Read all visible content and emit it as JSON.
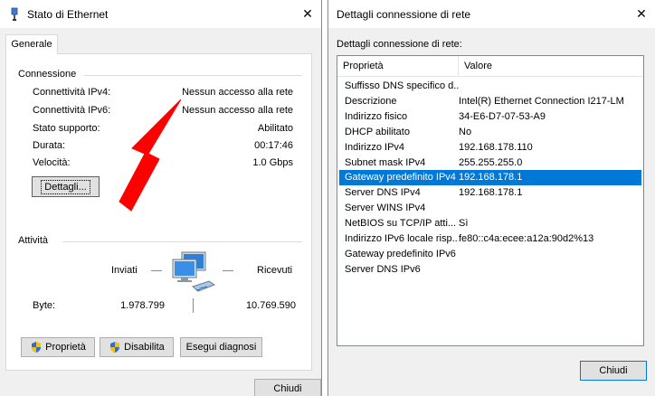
{
  "status_window": {
    "title": "Stato di Ethernet",
    "close_glyph": "✕",
    "tab": "Generale",
    "connection_group": "Connessione",
    "rows": [
      {
        "label": "Connettività IPv4:",
        "value": "Nessun accesso alla rete"
      },
      {
        "label": "Connettività IPv6:",
        "value": "Nessun accesso alla rete"
      },
      {
        "label": "Stato supporto:",
        "value": "Abilitato"
      },
      {
        "label": "Durata:",
        "value": "00:17:46"
      },
      {
        "label": "Velocità:",
        "value": "1.0 Gbps"
      }
    ],
    "details_button": "Dettagli...",
    "activity_group": "Attività",
    "sent_label": "Inviati",
    "received_label": "Ricevuti",
    "bytes_label": "Byte:",
    "bytes_sent": "1.978.799",
    "bytes_received": "10.769.590",
    "buttons": {
      "properties": "Proprietà",
      "disable": "Disabilita",
      "diagnose": "Esegui diagnosi",
      "close": "Chiudi"
    },
    "arrow_color": "#ff0000"
  },
  "details_window": {
    "title": "Dettagli connessione di rete",
    "close_glyph": "✕",
    "list_label": "Dettagli connessione di rete:",
    "columns": [
      "Proprietà",
      "Valore"
    ],
    "rows": [
      {
        "property": "Suffisso DNS specifico d...",
        "value": ""
      },
      {
        "property": "Descrizione",
        "value": "Intel(R) Ethernet Connection I217-LM"
      },
      {
        "property": "Indirizzo fisico",
        "value": "34-E6-D7-07-53-A9"
      },
      {
        "property": "DHCP abilitato",
        "value": "No"
      },
      {
        "property": "Indirizzo IPv4",
        "value": "192.168.178.110"
      },
      {
        "property": "Subnet mask IPv4",
        "value": "255.255.255.0"
      },
      {
        "property": "Gateway predefinito IPv4",
        "value": "192.168.178.1",
        "selected": true
      },
      {
        "property": "Server DNS IPv4",
        "value": "192.168.178.1"
      },
      {
        "property": "Server WINS IPv4",
        "value": ""
      },
      {
        "property": "NetBIOS su TCP/IP atti...",
        "value": "Sì"
      },
      {
        "property": "Indirizzo IPv6 locale risp...",
        "value": "fe80::c4a:ecee:a12a:90d2%13"
      },
      {
        "property": "Gateway predefinito IPv6",
        "value": ""
      },
      {
        "property": "Server DNS IPv6",
        "value": ""
      }
    ],
    "close_button": "Chiudi",
    "selection_color": "#0078d7"
  }
}
